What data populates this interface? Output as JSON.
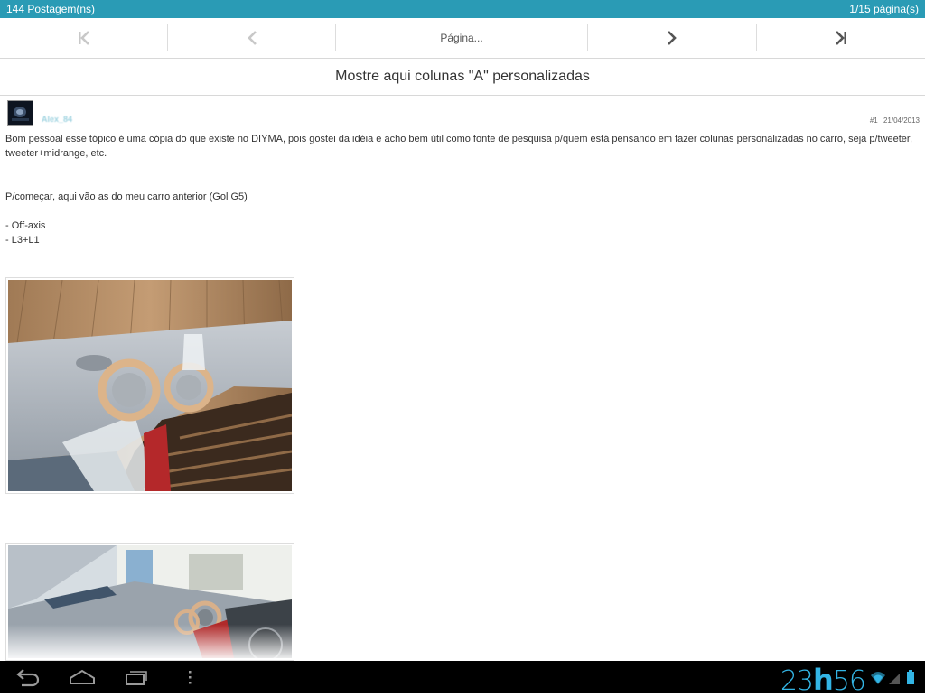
{
  "topbar": {
    "posts": "144 Postagem(ns)",
    "pages": "1/15 página(s)"
  },
  "pager": {
    "first_icon": "first-page-icon",
    "prev_icon": "prev-page-icon",
    "page_label": "Página...",
    "next_icon": "next-page-icon",
    "last_icon": "last-page-icon"
  },
  "thread": {
    "title": "Mostre aqui colunas \"A\" personalizadas"
  },
  "post": {
    "author": "Alex_84",
    "number": "#1",
    "date": "21/04/2013",
    "lines": [
      "Bom pessoal esse tópico é uma cópia do que existe no DIYMA, pois gostei da idéia e acho bem útil como fonte de pesquisa p/quem está pensando em fazer colunas personalizadas no carro, seja p/tweeter, tweeter+midrange, etc.",
      "",
      "",
      "P/começar, aqui vão as do meu carro anterior (Gol G5)",
      "",
      "- Off-axis",
      "- L3+L1"
    ]
  },
  "navbar": {
    "back_icon": "back-icon",
    "home_icon": "home-icon",
    "recents_icon": "recent-apps-icon",
    "menu_icon": "menu-icon",
    "clock_hours": "23",
    "clock_sep": "h",
    "clock_minutes": "56"
  },
  "colors": {
    "accent": "#2a9bb5",
    "clock": "#33b5e5"
  }
}
